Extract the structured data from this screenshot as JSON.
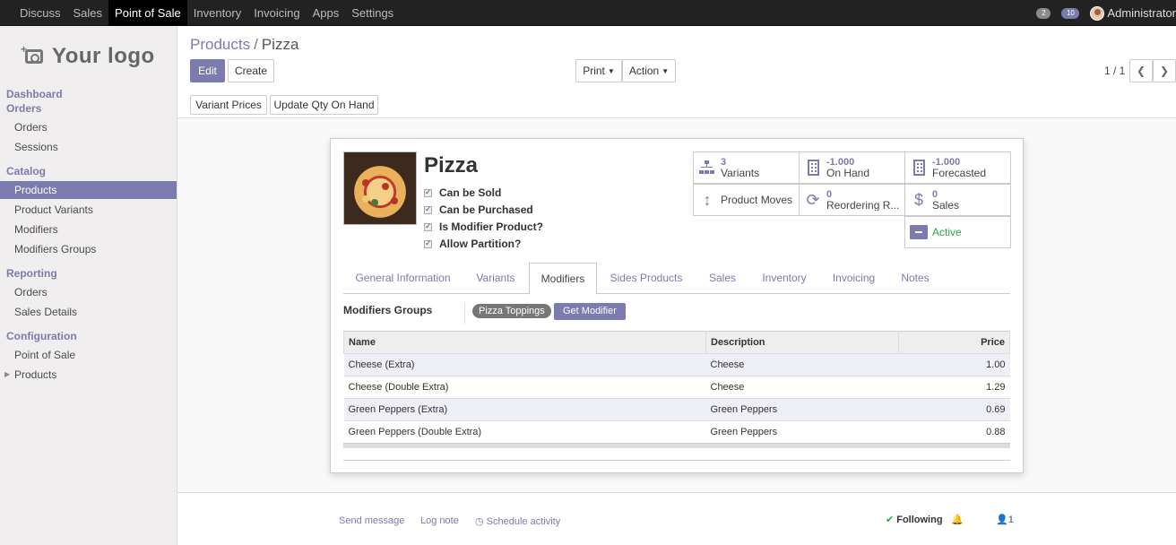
{
  "topbar": {
    "menu": [
      "Discuss",
      "Sales",
      "Point of Sale",
      "Inventory",
      "Invoicing",
      "Apps",
      "Settings"
    ],
    "active_menu": "Point of Sale",
    "chat_count": "2",
    "activity_count": "10",
    "user_name": "Administrator"
  },
  "sidebar": {
    "logo_text": "Your logo",
    "dashboard": "Dashboard",
    "orders_section": "Orders",
    "orders_items": [
      "Orders",
      "Sessions"
    ],
    "catalog_section": "Catalog",
    "catalog_items": [
      "Products",
      "Product Variants",
      "Modifiers",
      "Modifiers Groups"
    ],
    "reporting_section": "Reporting",
    "reporting_items": [
      "Orders",
      "Sales Details"
    ],
    "config_section": "Configuration",
    "config_items": [
      "Point of Sale",
      "Products"
    ]
  },
  "breadcrumb": {
    "parent": "Products",
    "separator": "/",
    "current": "Pizza"
  },
  "buttons": {
    "edit": "Edit",
    "create": "Create",
    "print": "Print",
    "action": "Action",
    "variant_prices": "Variant Prices",
    "update_qty": "Update Qty On Hand"
  },
  "pager": "1 / 1",
  "product": {
    "name": "Pizza",
    "checkboxes": [
      "Can be Sold",
      "Can be Purchased",
      "Is Modifier Product?",
      "Allow Partition?"
    ]
  },
  "stats": {
    "variants_num": "3",
    "variants_label": "Variants",
    "onhand_num": "-1.000",
    "onhand_label": "On Hand",
    "forecast_num": "-1.000",
    "forecast_label": "Forecasted",
    "moves_label": "Product Moves",
    "reorder_num": "0",
    "reorder_label": "Reordering R...",
    "sales_num": "0",
    "sales_label": "Sales",
    "active_label": "Active"
  },
  "tabs": [
    "General Information",
    "Variants",
    "Modifiers",
    "Sides Products",
    "Sales",
    "Inventory",
    "Invoicing",
    "Notes"
  ],
  "active_tab": "Modifiers",
  "modifiers": {
    "label": "Modifiers Groups",
    "tag": "Pizza Toppings",
    "get_button": "Get Modifier",
    "columns": [
      "Name",
      "Description",
      "Price"
    ],
    "rows": [
      {
        "name": "Cheese (Extra)",
        "description": "Cheese",
        "price": "1.00"
      },
      {
        "name": "Cheese (Double Extra)",
        "description": "Cheese",
        "price": "1.29"
      },
      {
        "name": "Green Peppers (Extra)",
        "description": "Green Peppers",
        "price": "0.69"
      },
      {
        "name": "Green Peppers (Double Extra)",
        "description": "Green Peppers",
        "price": "0.88"
      }
    ]
  },
  "chatter": {
    "send_message": "Send message",
    "log_note": "Log note",
    "schedule_activity": "Schedule activity",
    "following": "Following",
    "followers": "1"
  },
  "colors": {
    "accent": "#7c7bad",
    "active_green": "#28a745",
    "topbar": "#222222"
  }
}
